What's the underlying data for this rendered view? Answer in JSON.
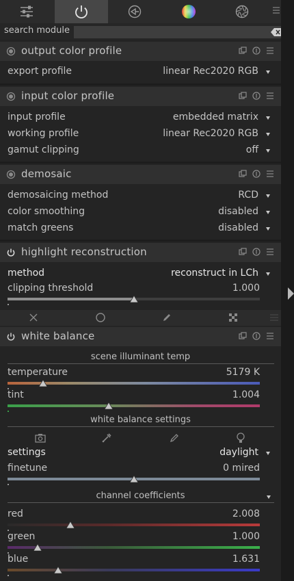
{
  "search": {
    "label": "search module",
    "value": "",
    "placeholder": ""
  },
  "modules": {
    "output_color_profile": {
      "title": "output color profile",
      "export_profile": {
        "label": "export profile",
        "value": "linear Rec2020 RGB"
      }
    },
    "input_color_profile": {
      "title": "input color profile",
      "input_profile": {
        "label": "input profile",
        "value": "embedded matrix"
      },
      "working_profile": {
        "label": "working profile",
        "value": "linear Rec2020 RGB"
      },
      "gamut_clipping": {
        "label": "gamut clipping",
        "value": "off"
      }
    },
    "demosaic": {
      "title": "demosaic",
      "method": {
        "label": "demosaicing method",
        "value": "RCD"
      },
      "color_smoothing": {
        "label": "color smoothing",
        "value": "disabled"
      },
      "match_greens": {
        "label": "match greens",
        "value": "disabled"
      }
    },
    "highlight_reconstruction": {
      "title": "highlight reconstruction",
      "method": {
        "label": "method",
        "value": "reconstruct in LCh"
      },
      "clipping_threshold": {
        "label": "clipping threshold",
        "value": "1.000",
        "position": 0.5
      }
    },
    "white_balance": {
      "title": "white balance",
      "scene_section": "scene illuminant temp",
      "temperature": {
        "label": "temperature",
        "value": "5179 K",
        "position": 0.14
      },
      "tint": {
        "label": "tint",
        "value": "1.004",
        "position": 0.4
      },
      "settings_section": "white balance settings",
      "settings": {
        "label": "settings",
        "value": "daylight"
      },
      "finetune": {
        "label": "finetune",
        "value": "0 mired",
        "position": 0.5
      },
      "coeff_section": "channel coefficients",
      "red": {
        "label": "red",
        "value": "2.008",
        "position": 0.25
      },
      "green": {
        "label": "green",
        "value": "1.000",
        "position": 0.12
      },
      "blue": {
        "label": "blue",
        "value": "1.631",
        "position": 0.2
      }
    }
  },
  "colors": {
    "panel": "#242424",
    "header": "#303030",
    "active_tab": "#474747",
    "text": "#c4c4c4"
  },
  "icons": {
    "tabs": [
      "sliders-icon",
      "power-icon",
      "color-correction-icon",
      "color-wheel-icon",
      "aperture-icon",
      "tab-menu-icon"
    ],
    "module_header": [
      "multi-instance-icon",
      "reset-icon",
      "presets-menu-icon"
    ],
    "blend_modes": [
      "blend-off-icon",
      "blend-uniform-icon",
      "blend-drawn-mask-icon",
      "blend-parametric-icon",
      "blend-more-icon"
    ],
    "white_balance_presets": [
      "camera-icon",
      "color-picker-icon",
      "user-modified-icon",
      "camera-reference-icon"
    ]
  }
}
